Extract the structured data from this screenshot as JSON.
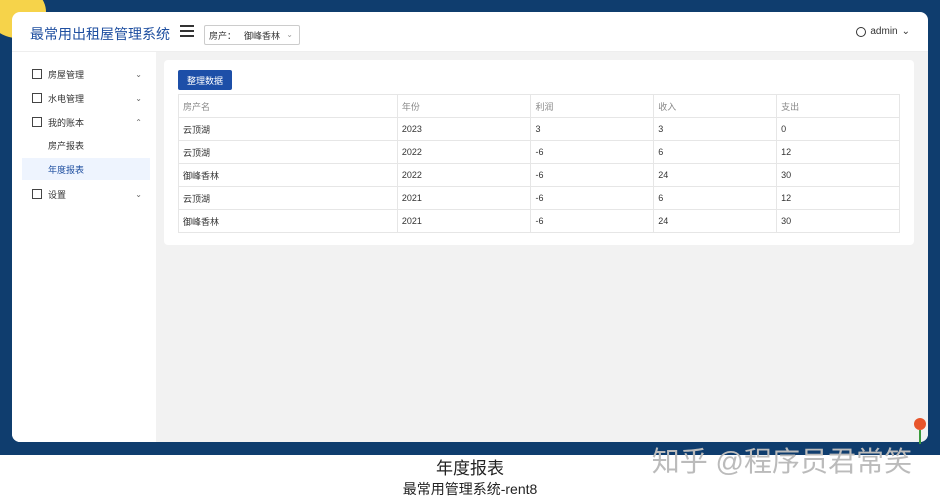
{
  "app": {
    "title": "最常用出租屋管理系统"
  },
  "header": {
    "property_label": "房产：",
    "property_value": "御峰香林",
    "user": "admin"
  },
  "sidebar": {
    "items": [
      {
        "label": "房屋管理"
      },
      {
        "label": "水电管理"
      },
      {
        "label": "我的账本"
      },
      {
        "label": "设置"
      }
    ],
    "subitems": [
      {
        "label": "房产报表"
      },
      {
        "label": "年度报表"
      }
    ]
  },
  "toolbar": {
    "sort_label": "整理数据"
  },
  "table": {
    "headers": [
      "房产名",
      "年份",
      "利润",
      "收入",
      "支出"
    ],
    "rows": [
      [
        "云顶湖",
        "2023",
        "3",
        "3",
        "0"
      ],
      [
        "云顶湖",
        "2022",
        "-6",
        "6",
        "12"
      ],
      [
        "御峰香林",
        "2022",
        "-6",
        "24",
        "30"
      ],
      [
        "云顶湖",
        "2021",
        "-6",
        "6",
        "12"
      ],
      [
        "御峰香林",
        "2021",
        "-6",
        "24",
        "30"
      ]
    ]
  },
  "caption": {
    "line1": "年度报表",
    "line2": "最常用管理系统-rent8"
  },
  "watermark": "知乎 @程序员君常笑"
}
